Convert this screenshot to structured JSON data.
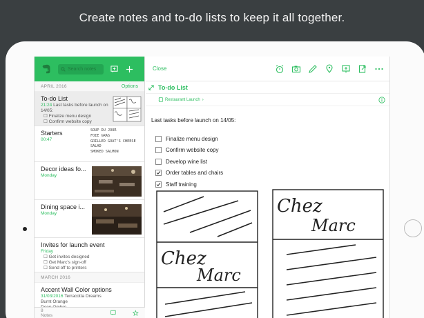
{
  "headline": "Create notes and to-do lists to keep it all together.",
  "sidebar": {
    "search_placeholder": "Search notes",
    "sections": {
      "april": "APRIL 2016",
      "march": "MARCH 2016"
    },
    "options_label": "Options",
    "notes": [
      {
        "title": "To-do List",
        "date": "21:24",
        "snippet": "Last tasks before launch on 14/05:",
        "snippet2": "Finalize menu design",
        "snippet3": "Confirm website copy"
      },
      {
        "title": "Starters",
        "date": "00:47"
      },
      {
        "title": "Decor ideas fo...",
        "date": "Monday"
      },
      {
        "title": "Dining space i...",
        "date": "Monday"
      },
      {
        "title": "Invites for launch event",
        "date": "Friday",
        "snippet": "Get invites designed",
        "snippet2": "Get Marc's sign-off",
        "snippet3": "Send off to printers"
      },
      {
        "title": "Accent Wall Color options",
        "date": "31/03/2016",
        "date_suffix": "Terracotta Dreams",
        "snippet": "Burnt Orange",
        "snippet2": "Deep Ombre"
      }
    ],
    "starters_menu": [
      "SOUP DU JOUR",
      "FOIE GRAS",
      "GRILLED GOAT'S CHEESE",
      "SALAD",
      "SMOKED SALMON"
    ],
    "count_label": "8 Notes"
  },
  "main": {
    "close_label": "Close",
    "note_title": "To-do List",
    "notebook_tag": "Restaurant Launch",
    "intro": "Last tasks before launch on 14/05:",
    "checklist": [
      {
        "label": "Finalize menu design",
        "checked": false
      },
      {
        "label": "Confirm website copy",
        "checked": false
      },
      {
        "label": "Develop wine list",
        "checked": false
      },
      {
        "label": "Order tables and chairs",
        "checked": true
      },
      {
        "label": "Staff training",
        "checked": true
      }
    ],
    "sketch_text": "Chez Marc"
  },
  "colors": {
    "accent": "#2dbe60",
    "background": "#3a3f41"
  },
  "icons": [
    "elephant-logo-icon",
    "search-icon",
    "new-chat-icon",
    "add-icon",
    "reminder-alarm-icon",
    "camera-icon",
    "pen-icon",
    "location-pin-icon",
    "presentation-icon",
    "share-icon",
    "more-icon",
    "expand-icon",
    "notebook-icon",
    "info-icon",
    "shortcut-star-icon"
  ]
}
